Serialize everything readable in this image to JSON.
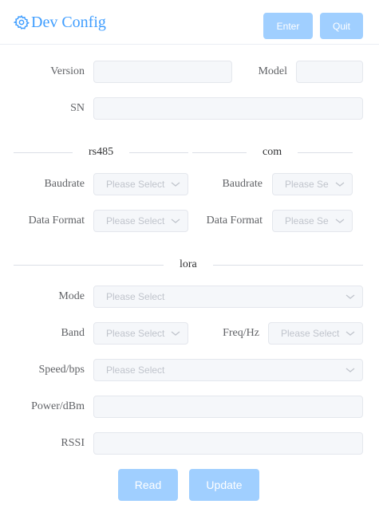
{
  "header": {
    "title": "Dev Config",
    "title_icon": "gear-icon",
    "enter_label": "Enter",
    "quit_label": "Quit"
  },
  "colors": {
    "accent": "#409eff",
    "button_disabled": "#a0cfff",
    "field_disabled_bg": "#f5f7fa",
    "placeholder": "#c0c4cc"
  },
  "device": {
    "version_label": "Version",
    "version_value": "",
    "model_label": "Model",
    "model_value": "",
    "sn_label": "SN",
    "sn_value": ""
  },
  "rs485": {
    "section_title": "rs485",
    "baudrate_label": "Baudrate",
    "baudrate_placeholder": "Please Select",
    "format_label": "Data Format",
    "format_placeholder": "Please Select"
  },
  "com": {
    "section_title": "com",
    "baudrate_label": "Baudrate",
    "baudrate_placeholder": "Please Se",
    "format_label": "Data Format",
    "format_placeholder": "Please Se"
  },
  "lora": {
    "section_title": "lora",
    "mode_label": "Mode",
    "mode_placeholder": "Please Select",
    "band_label": "Band",
    "band_placeholder": "Please Select",
    "freq_label": "Freq/Hz",
    "freq_placeholder": "Please Select",
    "speed_label": "Speed/bps",
    "speed_placeholder": "Please Select",
    "power_label": "Power/dBm",
    "power_value": "",
    "rssi_label": "RSSI",
    "rssi_value": ""
  },
  "actions": {
    "read_label": "Read",
    "update_label": "Update"
  }
}
